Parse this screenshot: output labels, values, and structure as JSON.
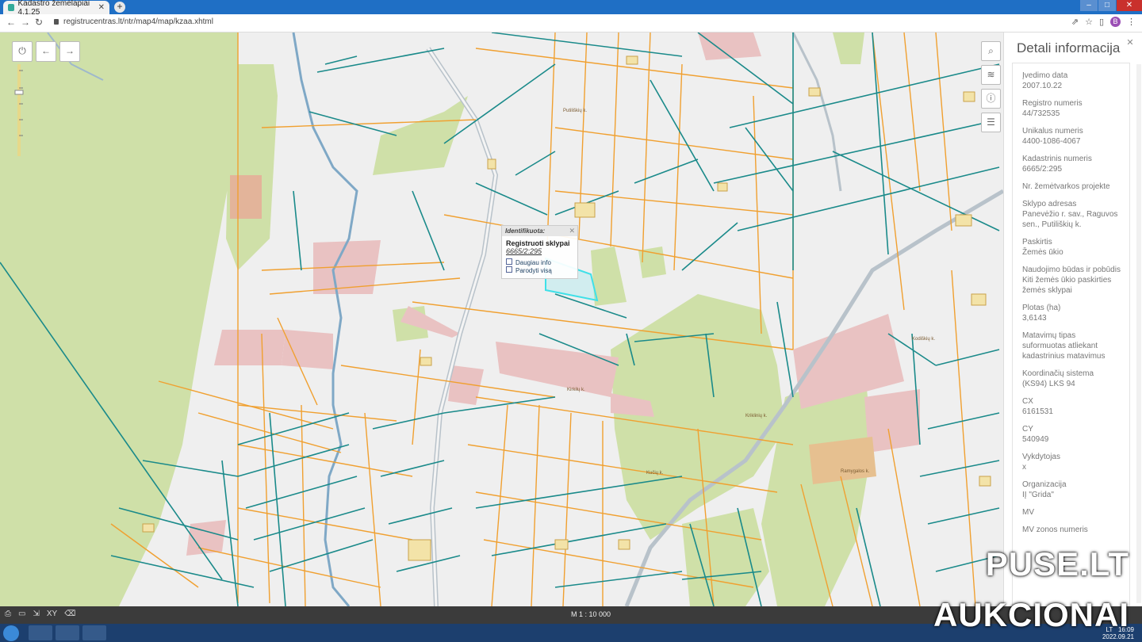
{
  "browser": {
    "tab_title": "Kadastro žemėlapiai 4.1.25",
    "url": "registrucentras.lt/ntr/map4/map/kzaa.xhtml"
  },
  "map": {
    "popup": {
      "header": "Identifikuota:",
      "title": "Registruoti sklypai",
      "number": "6665/2:295",
      "link_more": "Daugiau info",
      "link_show": "Parodyti visą"
    },
    "place_labels": [
      "Putiliškių k.",
      "Kodiškių k.",
      "Kirkilų k.",
      "Kriklinių k.",
      "Kučių k.",
      "Ramygalos k."
    ],
    "scale": "M 1 : 10 000"
  },
  "panel": {
    "title": "Detali informacija",
    "fields": [
      {
        "label": "Įvedimo data",
        "value": "2007.10.22"
      },
      {
        "label": "Registro numeris",
        "value": "44/732535"
      },
      {
        "label": "Unikalus numeris",
        "value": "4400-1086-4067"
      },
      {
        "label": "Kadastrinis numeris",
        "value": "6665/2:295"
      },
      {
        "label": "Nr. žemėtvarkos projekte",
        "value": ""
      },
      {
        "label": "Sklypo adresas",
        "value": "Panevėžio r. sav., Raguvos sen., Putiliškių k."
      },
      {
        "label": "Paskirtis",
        "value": "Žemės ūkio"
      },
      {
        "label": "Naudojimo būdas ir pobūdis",
        "value": "Kiti žemės ūkio paskirties žemės sklypai"
      },
      {
        "label": "Plotas (ha)",
        "value": "3,6143"
      },
      {
        "label": "Matavimų tipas",
        "value": "suformuotas atliekant kadastrinius matavimus"
      },
      {
        "label": "Koordinačių sistema",
        "value": "(KS94) LKS 94"
      },
      {
        "label": "CX",
        "value": "6161531"
      },
      {
        "label": "CY",
        "value": "540949"
      },
      {
        "label": "Vykdytojas",
        "value": "x"
      },
      {
        "label": "Organizacija",
        "value": "IĮ \"Grida\""
      },
      {
        "label": "MV",
        "value": ""
      },
      {
        "label": "MV zonos numeris",
        "value": ""
      }
    ]
  },
  "taskbar": {
    "lang": "LT",
    "time": "16:09",
    "date": "2022.09.21"
  },
  "watermark": {
    "line1": "PUSE.LT",
    "line2": "AUKCIONAI"
  }
}
